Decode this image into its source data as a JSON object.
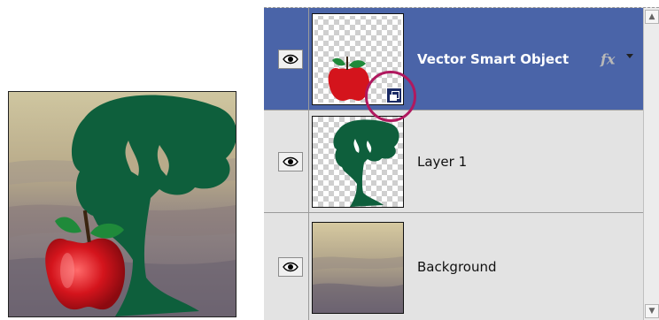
{
  "layers": [
    {
      "name": "Vector Smart Object",
      "visible": true,
      "selected": true,
      "has_fx": true,
      "fx_label": "fx",
      "smart_object": true
    },
    {
      "name": "Layer 1",
      "visible": true,
      "selected": false
    },
    {
      "name": "Background",
      "visible": true,
      "selected": false
    }
  ],
  "colors": {
    "selection": "#4a64a8",
    "tree": "#0e5f3c",
    "apple": "#d4141c",
    "callout": "#b0195f"
  },
  "icons": {
    "visibility": "eye-icon",
    "smart_object": "smart-object-badge-icon",
    "effects": "fx-icon",
    "menu": "chevron-down-icon"
  }
}
